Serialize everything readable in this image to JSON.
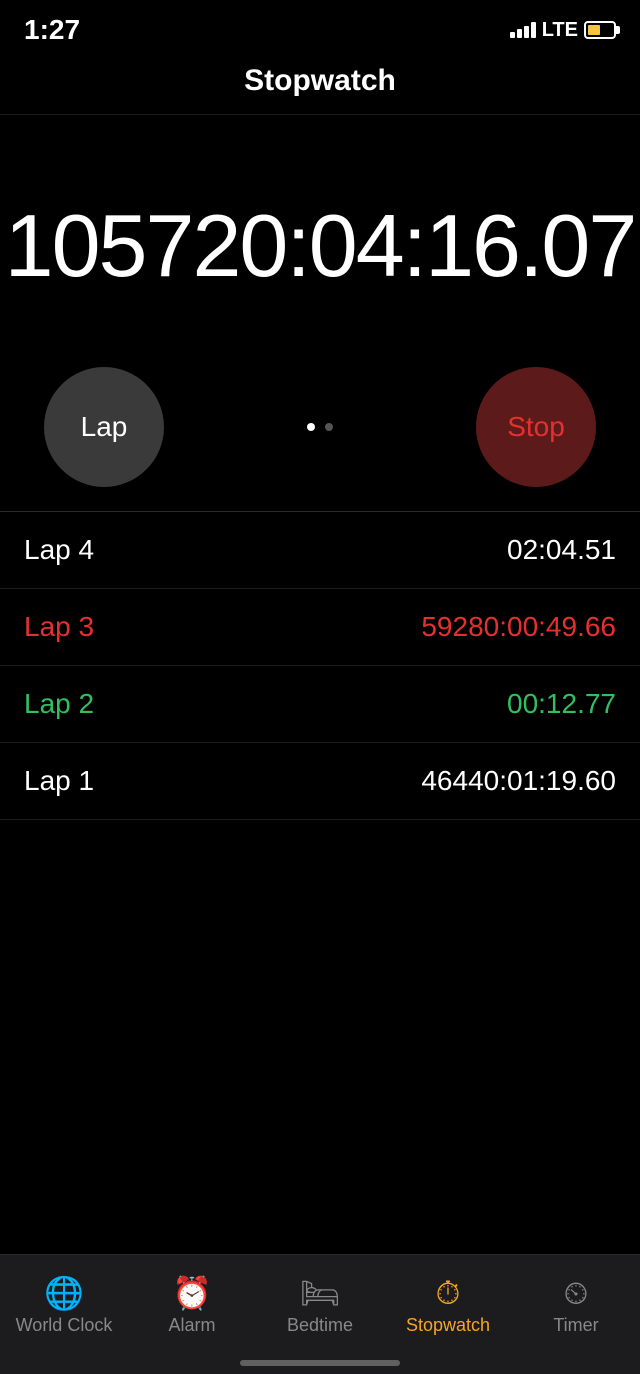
{
  "statusBar": {
    "time": "1:27",
    "lte": "LTE"
  },
  "header": {
    "title": "Stopwatch"
  },
  "timer": {
    "display": "105720:04:16.07"
  },
  "buttons": {
    "lap": "Lap",
    "stop": "Stop"
  },
  "laps": [
    {
      "id": "lap4",
      "label": "Lap 4",
      "time": "02:04.51",
      "color": "default"
    },
    {
      "id": "lap3",
      "label": "Lap 3",
      "time": "59280:00:49.66",
      "color": "red"
    },
    {
      "id": "lap2",
      "label": "Lap 2",
      "time": "00:12.77",
      "color": "green"
    },
    {
      "id": "lap1",
      "label": "Lap 1",
      "time": "46440:01:19.60",
      "color": "default"
    }
  ],
  "tabs": [
    {
      "id": "world-clock",
      "label": "World Clock",
      "icon": "🌐",
      "active": false
    },
    {
      "id": "alarm",
      "label": "Alarm",
      "icon": "⏰",
      "active": false
    },
    {
      "id": "bedtime",
      "label": "Bedtime",
      "icon": "🛏",
      "active": false
    },
    {
      "id": "stopwatch",
      "label": "Stopwatch",
      "icon": "⏱",
      "active": true
    },
    {
      "id": "timer",
      "label": "Timer",
      "icon": "⏲",
      "active": false
    }
  ]
}
